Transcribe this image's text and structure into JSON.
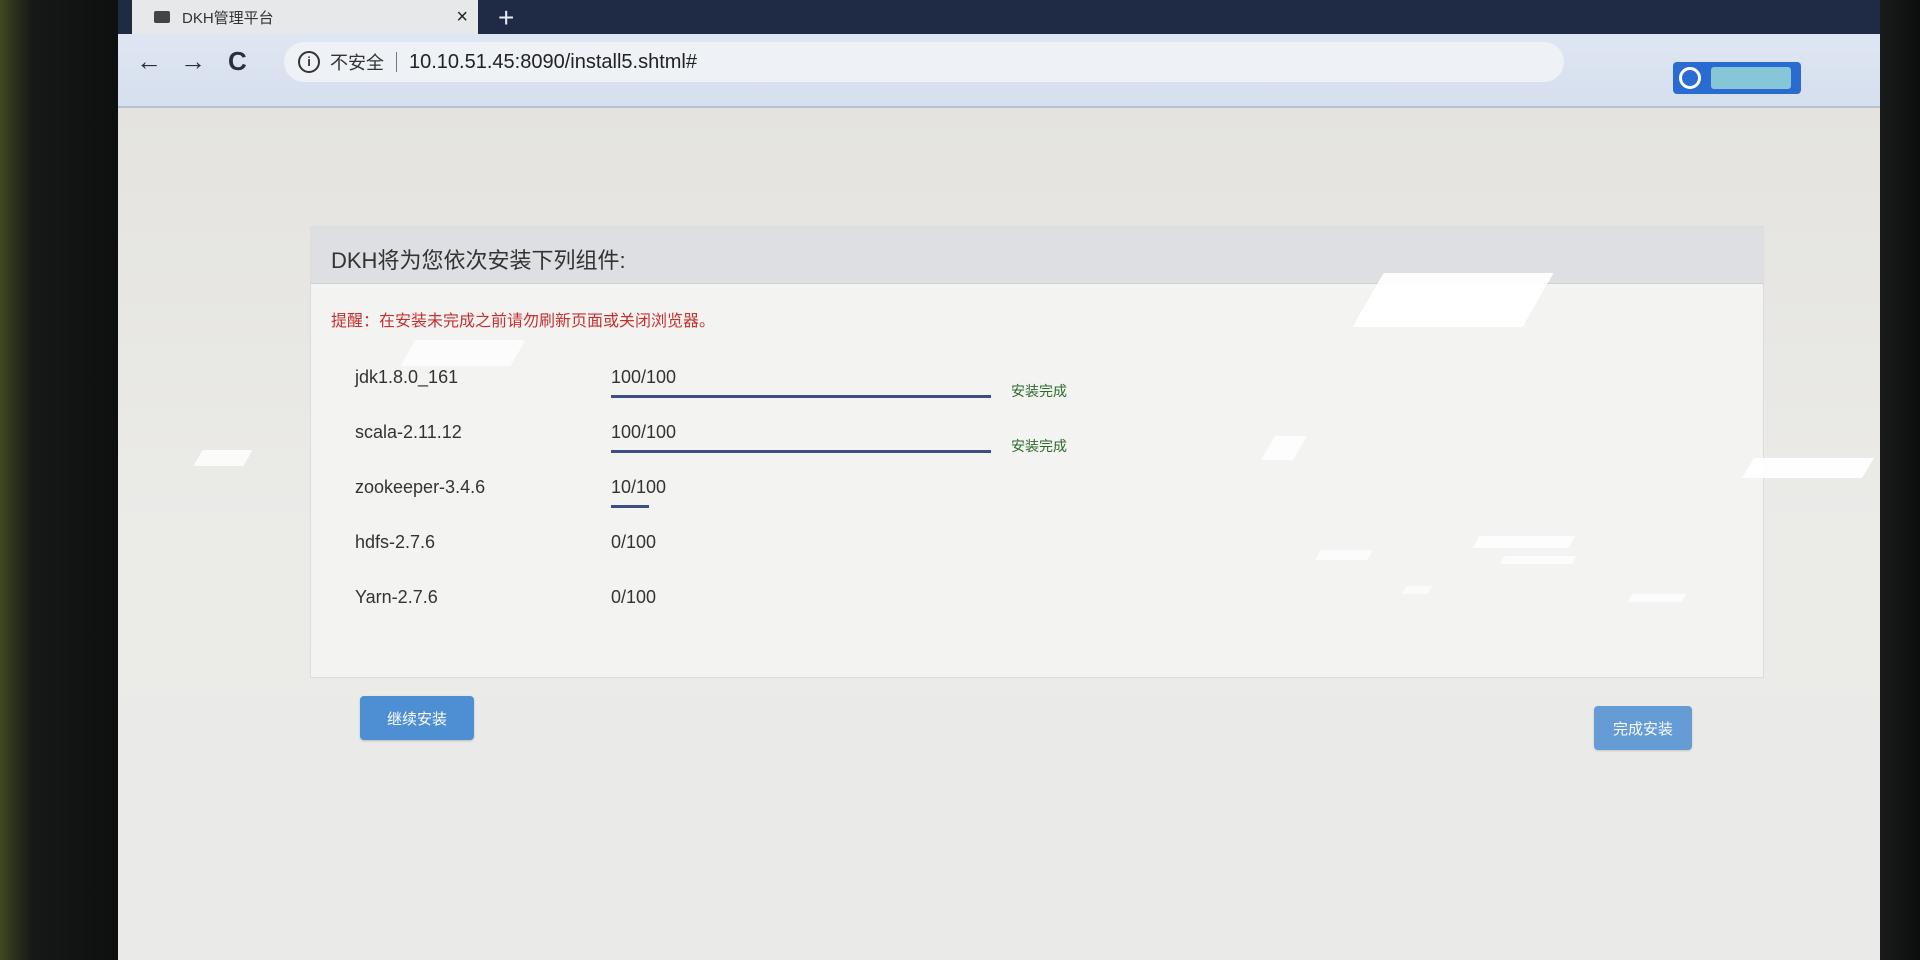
{
  "browser": {
    "tab_title": "DKH管理平台",
    "close_symbol": "×",
    "new_tab_symbol": "+",
    "back_symbol": "←",
    "forward_symbol": "→",
    "reload_symbol": "C",
    "security_label": "不安全",
    "url": "10.10.51.45:8090/install5.shtml#"
  },
  "panel": {
    "title": "DKH将为您依次安装下列组件:",
    "alert": "提醒：在安装未完成之前请勿刷新页面或关闭浏览器。"
  },
  "components": [
    {
      "name": "jdk1.8.0_161",
      "progress_text": "100/100",
      "progress": 1.0,
      "status": "安装完成"
    },
    {
      "name": "scala-2.11.12",
      "progress_text": "100/100",
      "progress": 1.0,
      "status": "安装完成"
    },
    {
      "name": "zookeeper-3.4.6",
      "progress_text": "10/100",
      "progress": 0.1,
      "status": ""
    },
    {
      "name": "hdfs-2.7.6",
      "progress_text": "0/100",
      "progress": 0.0,
      "status": ""
    },
    {
      "name": "Yarn-2.7.6",
      "progress_text": "0/100",
      "progress": 0.0,
      "status": ""
    }
  ],
  "buttons": {
    "continue_install": "继续安装",
    "finish_install": "完成安装"
  },
  "colors": {
    "alert_red": "#c8302f",
    "status_green": "#2c6b2c",
    "progress_navy": "#3b4f86",
    "button_blue": "#4e8fd4"
  }
}
